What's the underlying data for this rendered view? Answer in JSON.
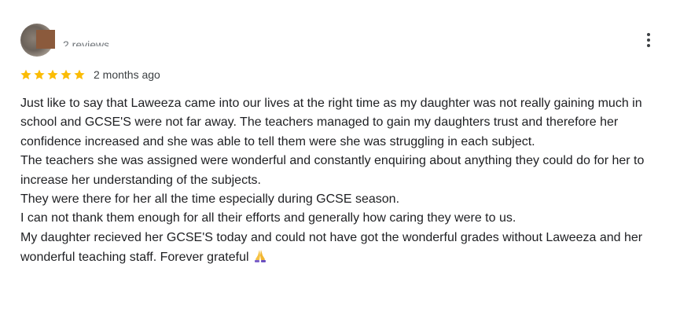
{
  "reviewer": {
    "meta": "2 reviews",
    "avatar_icon": "user-avatar"
  },
  "menu": {
    "icon": "more-vert-icon"
  },
  "rating": {
    "stars": 5,
    "max_stars": 5,
    "star_color": "#fbbc04",
    "date": "2 months ago"
  },
  "review": {
    "paragraphs": [
      "Just like to say that Laweeza came into our lives at the right time as my daughter was not really gaining much in school and GCSE'S were not far away. The teachers managed to gain my daughters trust and therefore her confidence increased and she was able to tell them were she was struggling in each subject.",
      "The teachers she was assigned were wonderful and constantly enquiring about anything they could do for her to increase her understanding of the subjects.",
      "They were there for her all the time especially during GCSE season.",
      "I can not thank them enough for all their efforts and generally how caring they were to us.",
      "My daughter recieved her GCSE'S today and could not have got the wonderful grades without Laweeza and her wonderful teaching staff. Forever grateful"
    ],
    "closing_icon": "folded-hands-icon"
  }
}
